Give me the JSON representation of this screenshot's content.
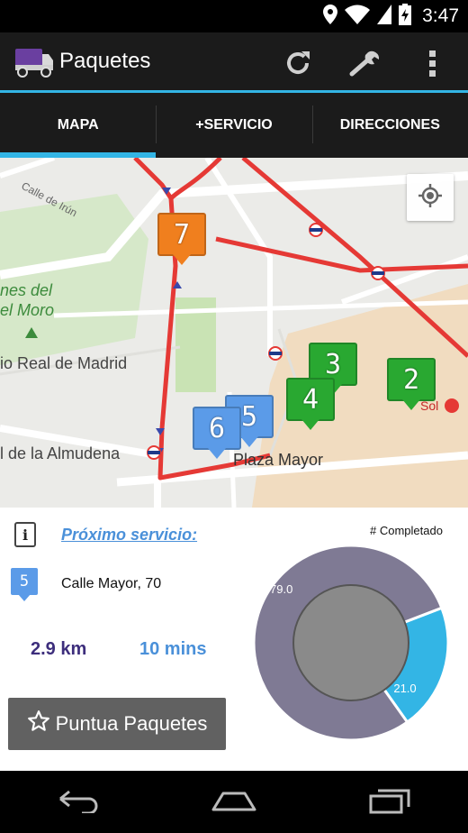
{
  "status_bar": {
    "time": "3:47"
  },
  "app": {
    "title": "Paquetes"
  },
  "tabs": [
    {
      "label": "MAPA",
      "active": true
    },
    {
      "label": "+SERVICIO",
      "active": false
    },
    {
      "label": "DIRECCIONES",
      "active": false
    }
  ],
  "map": {
    "labels": {
      "calle_irun": "Calle de Irún",
      "campo_moro": "nes del\nel Moro",
      "palacio": "io Real de Madrid",
      "almudena": "l de la Almudena",
      "plaza_mayor": "Plaza Mayor",
      "sol": "Sol"
    },
    "markers": [
      {
        "number": "7",
        "color": "#f07f1e",
        "status": "current"
      },
      {
        "number": "6",
        "color": "#5b9be8",
        "status": "pending"
      },
      {
        "number": "5",
        "color": "#5b9be8",
        "status": "pending"
      },
      {
        "number": "4",
        "color": "#29a831",
        "status": "completed"
      },
      {
        "number": "3",
        "color": "#29a831",
        "status": "completed"
      },
      {
        "number": "2",
        "color": "#29a831",
        "status": "completed"
      }
    ]
  },
  "next_service": {
    "link_label": "Próximo servicio:",
    "marker_number": "5",
    "address": "Calle Mayor, 70",
    "distance": "2.9 km",
    "duration": "10 mins"
  },
  "rate_button": {
    "label": "Puntua Paquetes"
  },
  "chart_data": {
    "type": "pie",
    "title": "# Completado",
    "slices": [
      {
        "label": "79.0",
        "value": 79.0,
        "color": "#7f7a94"
      },
      {
        "label": "21.0",
        "value": 21.0,
        "color": "#33b5e5"
      }
    ],
    "center_color": "#8a8a8a"
  }
}
